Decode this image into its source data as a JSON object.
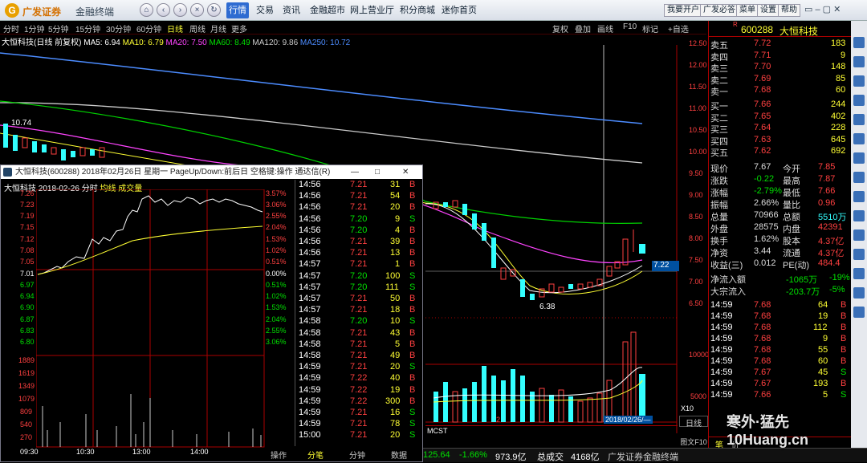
{
  "titlebar": {
    "brand": "广发证券",
    "product": "金融终端",
    "tabs": [
      "行情",
      "交易",
      "资讯",
      "金融超市",
      "网上营业厅",
      "积分商城",
      "迷你首页"
    ],
    "right_buttons": [
      "我要开户",
      "广发必答",
      "菜单",
      "设置",
      "帮助"
    ]
  },
  "periods": [
    "分时",
    "1分钟",
    "5分钟",
    "15分钟",
    "30分钟",
    "60分钟",
    "日线",
    "周线",
    "月线",
    "更多"
  ],
  "toolbar_right": [
    "复权",
    "叠加",
    "画线",
    "F10",
    "标记"
  ],
  "self_select": "+自选",
  "chart_header": {
    "name": "大恒科技(日线 前复权)",
    "ma5": "MA5: 6.94",
    "ma10": "MA10: 6.79",
    "ma20": "MA20: 7.50",
    "ma60": "MA60: 8.49",
    "ma120": "MA120: 9.86",
    "ma250": "MA250: 10.72"
  },
  "price_axis": [
    "12.50",
    "12.00",
    "11.50",
    "11.00",
    "10.50",
    "10.00",
    "9.50",
    "9.00",
    "8.50",
    "8.00",
    "7.50",
    "7.00",
    "6.50"
  ],
  "cursor_price": "7.22",
  "high_marker": "10.74",
  "low_marker": "6.38",
  "vol_axis": [
    "10000",
    "5000"
  ],
  "vol_unit": "X10",
  "bottom_date": "2018/02/26/—",
  "vol_marker": "2",
  "popup": {
    "title": "大恒科技(600288) 2018年02月26日 星期一 PageUp/Down:前后日 空格键:操作 通达信(R)",
    "sub": "大恒科技   2018-02-26 分时",
    "legend1": "均线",
    "legend2": "成交量",
    "price_ticks": [
      "7.26",
      "7.23",
      "7.19",
      "7.15",
      "7.12",
      "7.08",
      "7.05",
      "7.01",
      "6.97",
      "6.94",
      "6.90",
      "6.87",
      "6.83",
      "6.80"
    ],
    "pct_ticks": [
      "3.57%",
      "3.06%",
      "2.55%",
      "2.04%",
      "1.53%",
      "1.02%",
      "0.51%",
      "0.00%",
      "0.51%",
      "1.02%",
      "1.53%",
      "2.04%",
      "2.55%",
      "3.06%"
    ],
    "vol_ticks": [
      "1889",
      "1619",
      "1349",
      "1079",
      "809",
      "540",
      "270"
    ],
    "time_ticks": [
      "09:30",
      "10:30",
      "13:00",
      "14:00"
    ],
    "bottom_tabs": [
      "操作",
      "分笔",
      "分钟",
      "数据"
    ],
    "trades": [
      [
        "14:56",
        "7.21",
        "31",
        "B"
      ],
      [
        "14:56",
        "7.21",
        "54",
        "B"
      ],
      [
        "14:56",
        "7.21",
        "20",
        "B"
      ],
      [
        "14:56",
        "7.20",
        "9",
        "S"
      ],
      [
        "14:56",
        "7.20",
        "4",
        "B"
      ],
      [
        "14:56",
        "7.21",
        "39",
        "B"
      ],
      [
        "14:56",
        "7.21",
        "13",
        "B"
      ],
      [
        "14:57",
        "7.21",
        "1",
        "B"
      ],
      [
        "14:57",
        "7.20",
        "100",
        "S"
      ],
      [
        "14:57",
        "7.20",
        "111",
        "S"
      ],
      [
        "14:57",
        "7.21",
        "50",
        "B"
      ],
      [
        "14:57",
        "7.21",
        "18",
        "B"
      ],
      [
        "14:58",
        "7.20",
        "10",
        "S"
      ],
      [
        "14:58",
        "7.21",
        "43",
        "B"
      ],
      [
        "14:58",
        "7.21",
        "5",
        "B"
      ],
      [
        "14:58",
        "7.21",
        "49",
        "B"
      ],
      [
        "14:59",
        "7.21",
        "20",
        "S"
      ],
      [
        "14:59",
        "7.22",
        "40",
        "B"
      ],
      [
        "14:59",
        "7.22",
        "19",
        "B"
      ],
      [
        "14:59",
        "7.22",
        "300",
        "B"
      ],
      [
        "14:59",
        "7.21",
        "16",
        "S"
      ],
      [
        "14:59",
        "7.21",
        "78",
        "S"
      ],
      [
        "15:00",
        "7.21",
        "20",
        "S"
      ]
    ]
  },
  "quote": {
    "code": "600288",
    "name": "大恒科技",
    "asks": [
      [
        "卖五",
        "7.72",
        "183"
      ],
      [
        "卖四",
        "7.71",
        "9"
      ],
      [
        "卖三",
        "7.70",
        "148"
      ],
      [
        "卖二",
        "7.69",
        "85"
      ],
      [
        "卖一",
        "7.68",
        "60"
      ]
    ],
    "bids": [
      [
        "买一",
        "7.66",
        "244"
      ],
      [
        "买二",
        "7.65",
        "402"
      ],
      [
        "买三",
        "7.64",
        "228"
      ],
      [
        "买四",
        "7.63",
        "645"
      ],
      [
        "买五",
        "7.62",
        "692"
      ]
    ],
    "stats": [
      [
        "现价",
        "7.67",
        "今开",
        "7.85"
      ],
      [
        "涨跌",
        "-0.22",
        "最高",
        "7.87"
      ],
      [
        "涨幅",
        "-2.79%",
        "最低",
        "7.66"
      ],
      [
        "振幅",
        "2.66%",
        "量比",
        "0.96"
      ],
      [
        "总量",
        "70966",
        "总额",
        "5510万"
      ],
      [
        "外盘",
        "28575",
        "内盘",
        "42391"
      ],
      [
        "换手",
        "1.62%",
        "股本",
        "4.37亿"
      ],
      [
        "净资",
        "3.44",
        "流通",
        "4.37亿"
      ],
      [
        "收益(三)",
        "0.012",
        "PE(动)",
        "484.4"
      ]
    ],
    "flow": [
      [
        "净流入额",
        "-1065万",
        "-19%"
      ],
      [
        "大宗流入",
        "-203.7万",
        "-5%"
      ]
    ],
    "ticks": [
      [
        "14:59",
        "7.68",
        "64",
        "B"
      ],
      [
        "14:59",
        "7.68",
        "19",
        "B"
      ],
      [
        "14:59",
        "7.68",
        "112",
        "B"
      ],
      [
        "14:59",
        "7.68",
        "9",
        "B"
      ],
      [
        "14:59",
        "7.68",
        "55",
        "B"
      ],
      [
        "14:59",
        "7.68",
        "60",
        "B"
      ],
      [
        "14:59",
        "7.67",
        "45",
        "S"
      ],
      [
        "14:59",
        "7.67",
        "193",
        "B"
      ],
      [
        "14:59",
        "7.66",
        "5",
        "S"
      ]
    ],
    "bottom_tabs": [
      "笔",
      "价"
    ]
  },
  "status": {
    "index_val": "125.64",
    "index_pct": "-1.66%",
    "amount": "973.9亿",
    "total_label": "总成交",
    "total": "4168亿",
    "broker": "广发证券金融终端"
  },
  "right_labels": [
    "日线",
    "图文F10"
  ],
  "watermark": "寒外·猛先 10Huang.cn"
}
